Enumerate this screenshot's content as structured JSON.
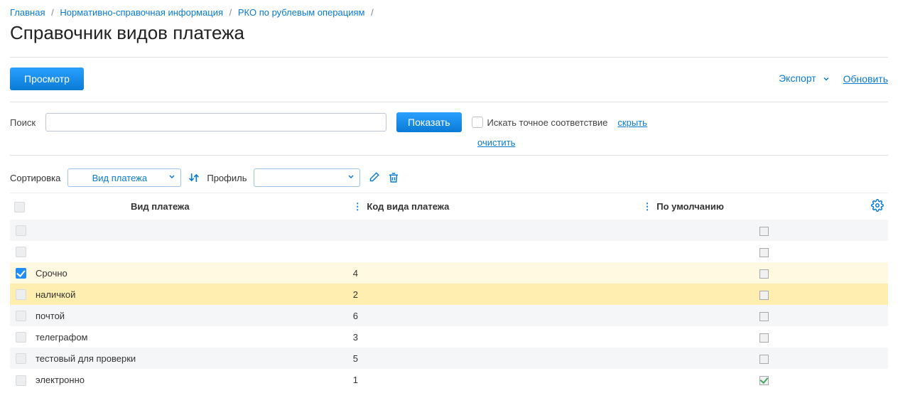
{
  "breadcrumb": {
    "home": "Главная",
    "sep": "/",
    "nsi": "Нормативно-справочная информация",
    "rko": "РКО по рублевым операциям"
  },
  "page_title": "Справочник видов платежа",
  "toolbar": {
    "view_btn": "Просмотр",
    "export": "Экспорт",
    "refresh": "Обновить"
  },
  "search": {
    "label": "Поиск",
    "value": "",
    "submit": "Показать",
    "exact_label": "Искать точное соответствие",
    "hide": "скрыть",
    "clear": "очистить"
  },
  "sort": {
    "label": "Сортировка",
    "sort_value": "Вид платежа",
    "profile_label": "Профиль",
    "profile_value": ""
  },
  "table": {
    "headers": {
      "name": "Вид платежа",
      "code": "Код вида платежа",
      "default": "По умолчанию"
    },
    "rows": [
      {
        "name": "",
        "code": "",
        "default": false,
        "checked": false,
        "state": "even"
      },
      {
        "name": "",
        "code": "",
        "default": false,
        "checked": false,
        "state": "odd"
      },
      {
        "name": "Срочно",
        "code": "4",
        "default": false,
        "checked": true,
        "state": "sel"
      },
      {
        "name": "наличкой",
        "code": "2",
        "default": false,
        "checked": false,
        "state": "hov"
      },
      {
        "name": "почтой",
        "code": "6",
        "default": false,
        "checked": false,
        "state": "even"
      },
      {
        "name": "телеграфом",
        "code": "3",
        "default": false,
        "checked": false,
        "state": "odd"
      },
      {
        "name": "тестовый для проверки",
        "code": "5",
        "default": false,
        "checked": false,
        "state": "even"
      },
      {
        "name": "электронно",
        "code": "1",
        "default": true,
        "checked": false,
        "state": "odd"
      }
    ]
  }
}
